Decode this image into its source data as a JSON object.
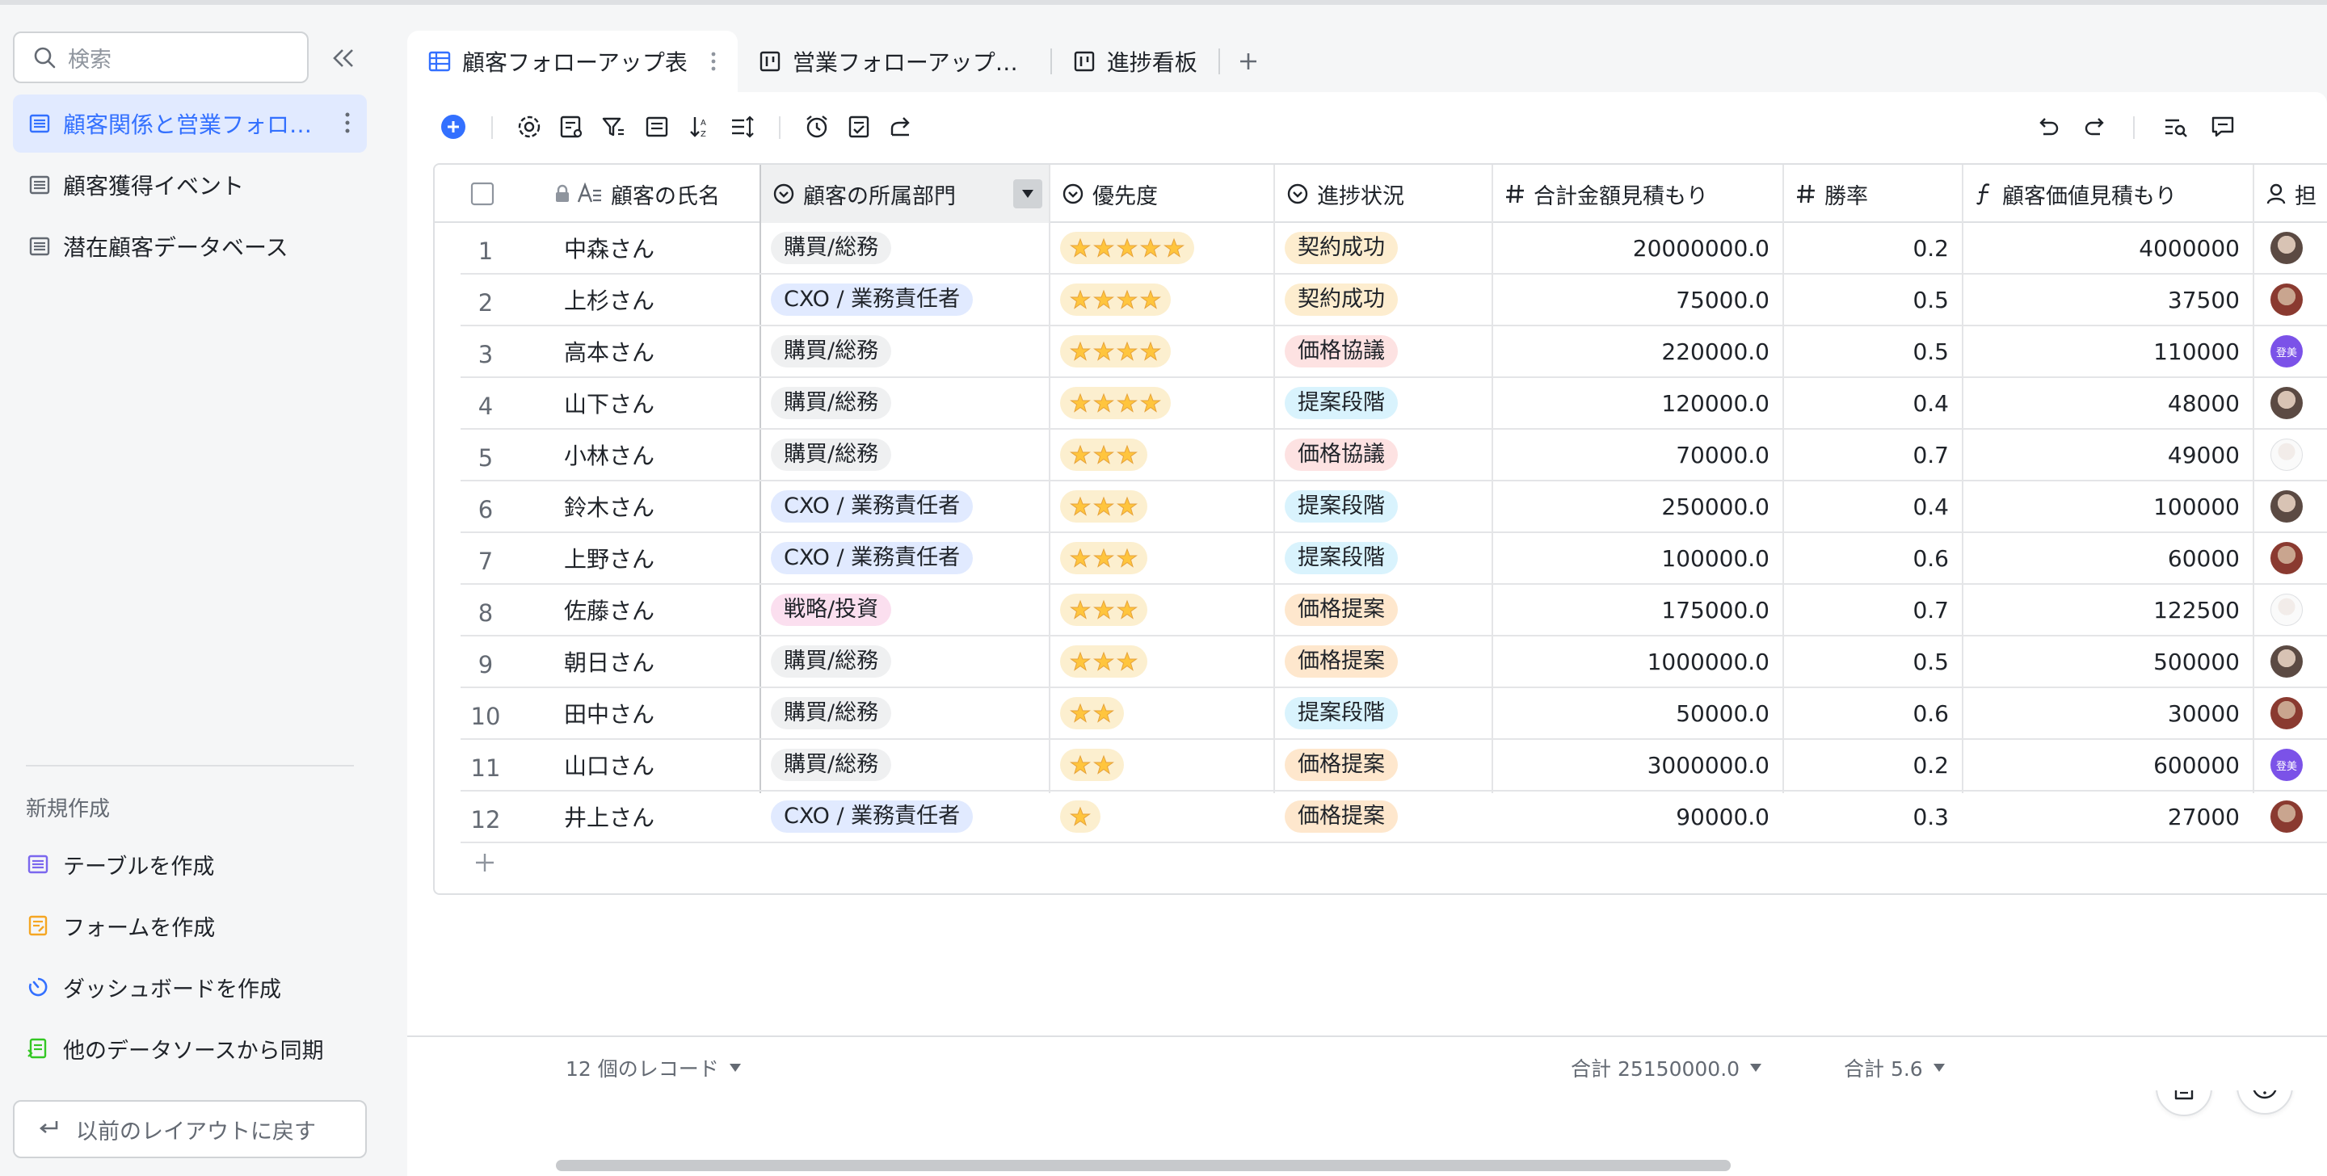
{
  "sidebar": {
    "search_placeholder": "検索",
    "items": [
      {
        "label": "顧客関係と営業フォロ…",
        "active": true
      },
      {
        "label": "顧客獲得イベント"
      },
      {
        "label": "潜在顧客データベース"
      }
    ],
    "create_title": "新規作成",
    "create_items": [
      {
        "label": "テーブルを作成",
        "icon": "table-icon"
      },
      {
        "label": "フォームを作成",
        "icon": "form-icon"
      },
      {
        "label": "ダッシュボードを作成",
        "icon": "dashboard-icon"
      },
      {
        "label": "他のデータソースから同期",
        "icon": "sync-icon"
      }
    ],
    "back_label": "以前のレイアウトに戻す"
  },
  "tabs": [
    {
      "label": "顧客フォローアップ表",
      "active": true
    },
    {
      "label": "営業フォローアップ…"
    },
    {
      "label": "進捗看板"
    }
  ],
  "columns": [
    {
      "label": "顧客の氏名",
      "icon": "text-field-icon"
    },
    {
      "label": "顧客の所属部門",
      "icon": "single-select-icon"
    },
    {
      "label": "優先度",
      "icon": "single-select-icon"
    },
    {
      "label": "進捗状況",
      "icon": "single-select-icon"
    },
    {
      "label": "合計金額見積もり",
      "icon": "number-icon"
    },
    {
      "label": "勝率",
      "icon": "number-icon"
    },
    {
      "label": "顧客価値見積もり",
      "icon": "formula-icon"
    },
    {
      "label": "担",
      "icon": "person-icon"
    }
  ],
  "rows": [
    {
      "idx": "1",
      "name": "中森さん",
      "dept": "購買/総務",
      "stars": 5,
      "status": "契約成功",
      "amount": "20000000.0",
      "rate": "0.2",
      "value": "4000000",
      "avatar": "photo-a"
    },
    {
      "idx": "2",
      "name": "上杉さん",
      "dept": "CXO / 業務責任者",
      "stars": 4,
      "status": "契約成功",
      "amount": "75000.0",
      "rate": "0.5",
      "value": "37500",
      "avatar": "photo-b"
    },
    {
      "idx": "3",
      "name": "高本さん",
      "dept": "購買/総務",
      "stars": 4,
      "status": "価格協議",
      "amount": "220000.0",
      "rate": "0.5",
      "value": "110000",
      "avatar": "purple",
      "avatar_text": "登美"
    },
    {
      "idx": "4",
      "name": "山下さん",
      "dept": "購買/総務",
      "stars": 4,
      "status": "提案段階",
      "amount": "120000.0",
      "rate": "0.4",
      "value": "48000",
      "avatar": "photo-a"
    },
    {
      "idx": "5",
      "name": "小林さん",
      "dept": "購買/総務",
      "stars": 3,
      "status": "価格協議",
      "amount": "70000.0",
      "rate": "0.7",
      "value": "49000",
      "avatar": "photo-c"
    },
    {
      "idx": "6",
      "name": "鈴木さん",
      "dept": "CXO / 業務責任者",
      "stars": 3,
      "status": "提案段階",
      "amount": "250000.0",
      "rate": "0.4",
      "value": "100000",
      "avatar": "photo-a"
    },
    {
      "idx": "7",
      "name": "上野さん",
      "dept": "CXO / 業務責任者",
      "stars": 3,
      "status": "提案段階",
      "amount": "100000.0",
      "rate": "0.6",
      "value": "60000",
      "avatar": "photo-b"
    },
    {
      "idx": "8",
      "name": "佐藤さん",
      "dept": "戦略/投資",
      "stars": 3,
      "status": "価格提案",
      "amount": "175000.0",
      "rate": "0.7",
      "value": "122500",
      "avatar": "photo-c"
    },
    {
      "idx": "9",
      "name": "朝日さん",
      "dept": "購買/総務",
      "stars": 3,
      "status": "価格提案",
      "amount": "1000000.0",
      "rate": "0.5",
      "value": "500000",
      "avatar": "photo-a"
    },
    {
      "idx": "10",
      "name": "田中さん",
      "dept": "購買/総務",
      "stars": 2,
      "status": "提案段階",
      "amount": "50000.0",
      "rate": "0.6",
      "value": "30000",
      "avatar": "photo-b"
    },
    {
      "idx": "11",
      "name": "山口さん",
      "dept": "購買/総務",
      "stars": 2,
      "status": "価格提案",
      "amount": "3000000.0",
      "rate": "0.2",
      "value": "600000",
      "avatar": "purple",
      "avatar_text": "登美"
    },
    {
      "idx": "12",
      "name": "井上さん",
      "dept": "CXO / 業務責任者",
      "stars": 1,
      "status": "価格提案",
      "amount": "90000.0",
      "rate": "0.3",
      "value": "27000",
      "avatar": "photo-b"
    }
  ],
  "footer": {
    "record_count": "12 個のレコード",
    "sum_amount": "合計 25150000.0",
    "sum_rate": "合計 5.6"
  },
  "colors": {
    "accent": "#3370ff",
    "tag_grey": "#eff0f1",
    "tag_blue": "#e1eaff",
    "tag_pink": "#fbdfef",
    "status_success": "#fdedcf",
    "status_negotiation": "#fde2e2",
    "status_proposal": "#d9f3fd",
    "status_price": "#fee7cd"
  }
}
